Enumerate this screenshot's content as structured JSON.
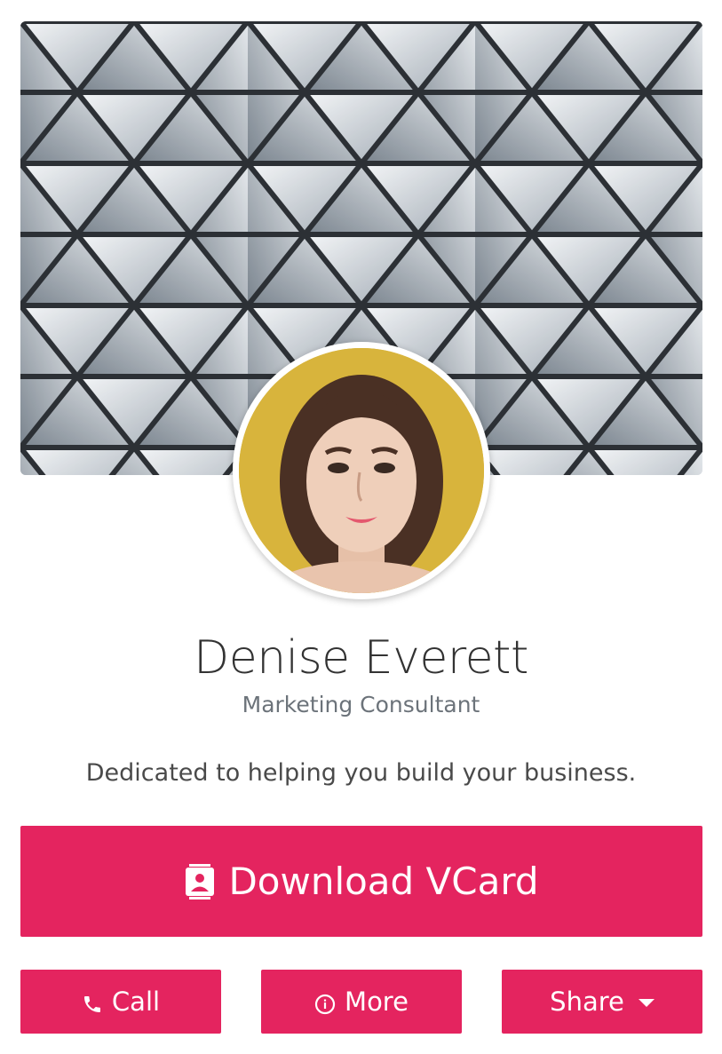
{
  "profile": {
    "name": "Denise Everett",
    "title": "Marketing Consultant",
    "bio": "Dedicated to helping you build your business."
  },
  "actions": {
    "vcard_label": "Download VCard",
    "call_label": "Call",
    "more_label": "More",
    "share_label": "Share"
  },
  "icons": {
    "vcard": "contact-card-icon",
    "call": "phone-icon",
    "more": "info-circle-icon",
    "share": "caret-down-icon"
  },
  "colors": {
    "accent": "#e4245f",
    "name_text": "#333333",
    "title_text": "#6c737a",
    "bio_text": "#4a4a4a"
  }
}
